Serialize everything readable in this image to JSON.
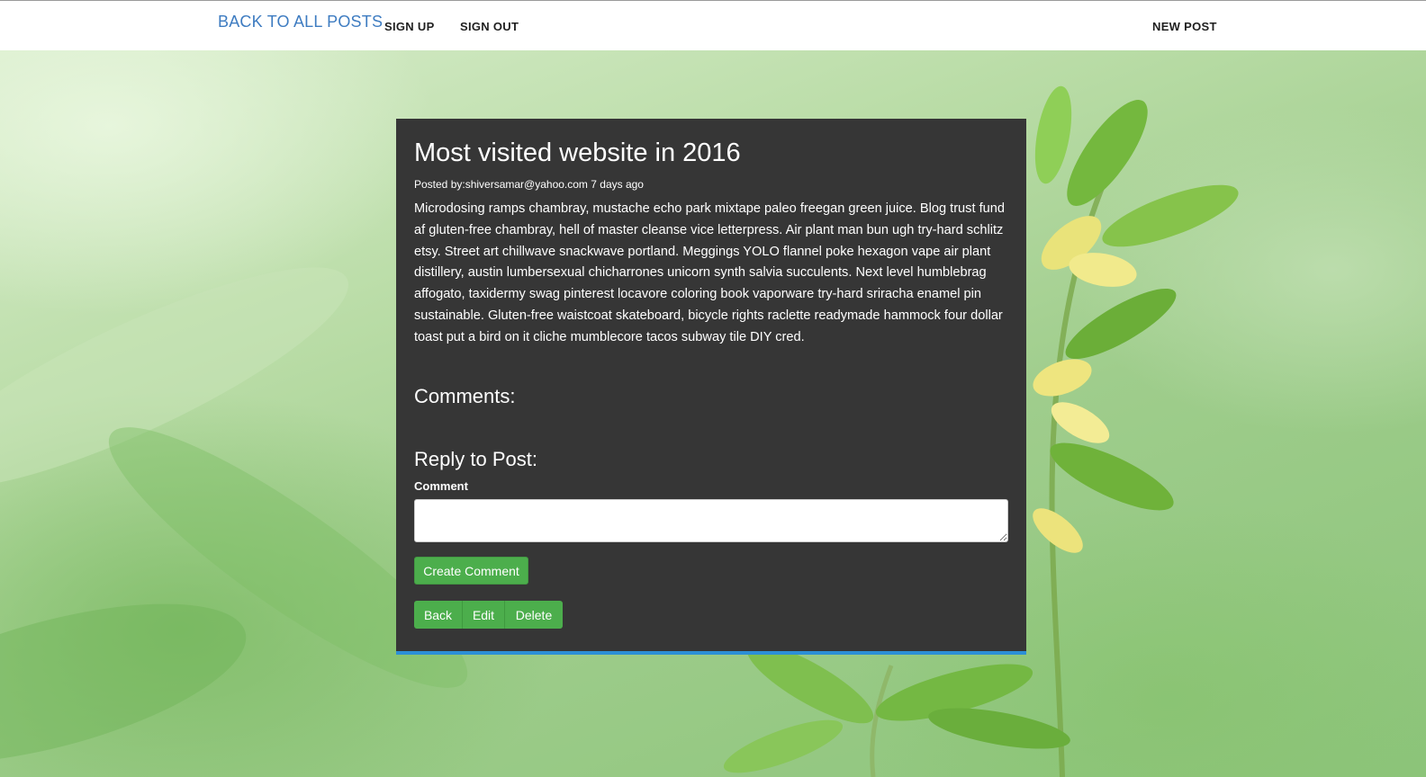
{
  "nav": {
    "brand": "BACK TO ALL POSTS",
    "sign_up": "SIGN UP",
    "sign_out": "SIGN OUT",
    "new_post": "NEW POST"
  },
  "post": {
    "title": "Most visited website in 2016",
    "meta": "Posted by:shiversamar@yahoo.com 7 days ago",
    "body": "Microdosing ramps chambray, mustache echo park mixtape paleo freegan green juice. Blog trust fund af gluten-free chambray, hell of master cleanse vice letterpress. Air plant man bun ugh try-hard schlitz etsy. Street art chillwave snackwave portland. Meggings YOLO flannel poke hexagon vape air plant distillery, austin lumbersexual chicharrones unicorn synth salvia succulents. Next level humblebrag affogato, taxidermy swag pinterest locavore coloring book vaporware try-hard sriracha enamel pin sustainable. Gluten-free waistcoat skateboard, bicycle rights raclette readymade hammock four dollar toast put a bird on it cliche mumblecore tacos subway tile DIY cred."
  },
  "comments": {
    "heading": "Comments:"
  },
  "reply": {
    "heading": "Reply to Post:",
    "comment_label": "Comment",
    "comment_value": "",
    "create_button": "Create Comment"
  },
  "actions": {
    "back": "Back",
    "edit": "Edit",
    "delete": "Delete"
  },
  "colors": {
    "brand_link": "#3e7cc1",
    "card_background": "#363636",
    "card_accent": "#2c8fd6",
    "button_green": "#4cae4c"
  }
}
